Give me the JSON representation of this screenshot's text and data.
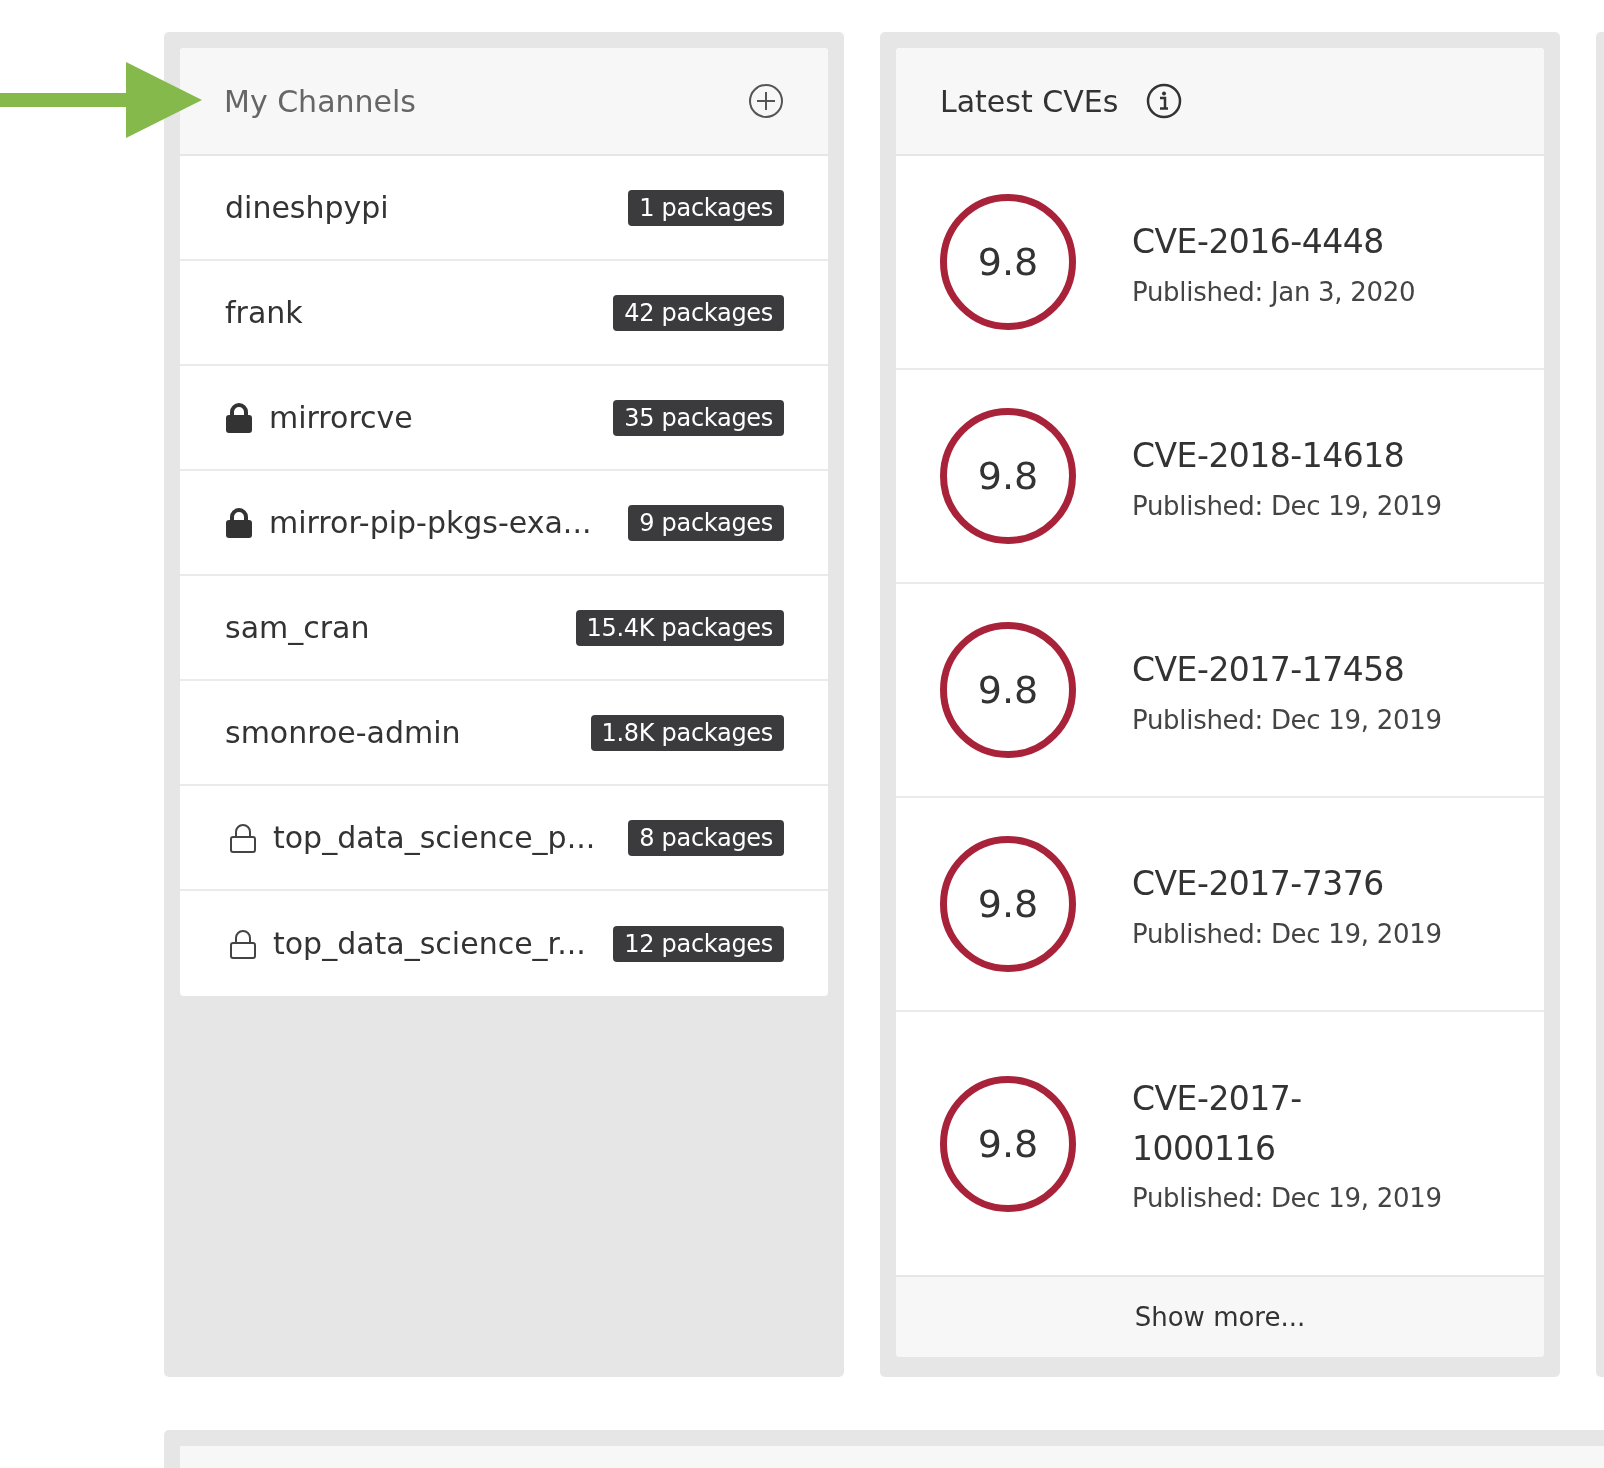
{
  "channels_panel": {
    "title": "My Channels",
    "items": [
      {
        "name": "dineshpypi",
        "count": "1 packages",
        "kind": "public"
      },
      {
        "name": "frank",
        "count": "42 packages",
        "kind": "public"
      },
      {
        "name": "mirrorcve",
        "count": "35 packages",
        "kind": "private"
      },
      {
        "name": "mirror-pip-pkgs-exa...",
        "count": "9 packages",
        "kind": "private"
      },
      {
        "name": "sam_cran",
        "count": "15.4K packages",
        "kind": "public"
      },
      {
        "name": "smonroe-admin",
        "count": "1.8K packages",
        "kind": "public"
      },
      {
        "name": "top_data_science_p...",
        "count": "8 packages",
        "kind": "restricted"
      },
      {
        "name": "top_data_science_r...",
        "count": "12 packages",
        "kind": "restricted"
      }
    ]
  },
  "cves_panel": {
    "title": "Latest CVEs",
    "items": [
      {
        "score": "9.8",
        "id": "CVE-2016-4448",
        "published": "Published: Jan 3, 2020"
      },
      {
        "score": "9.8",
        "id": "CVE-2018-14618",
        "published": "Published: Dec 19, 2019"
      },
      {
        "score": "9.8",
        "id": "CVE-2017-17458",
        "published": "Published: Dec 19, 2019"
      },
      {
        "score": "9.8",
        "id": "CVE-2017-7376",
        "published": "Published: Dec 19, 2019"
      },
      {
        "score": "9.8",
        "id": "CVE-2017-1000116",
        "published": "Published: Dec 19, 2019"
      }
    ],
    "show_more": "Show more..."
  }
}
